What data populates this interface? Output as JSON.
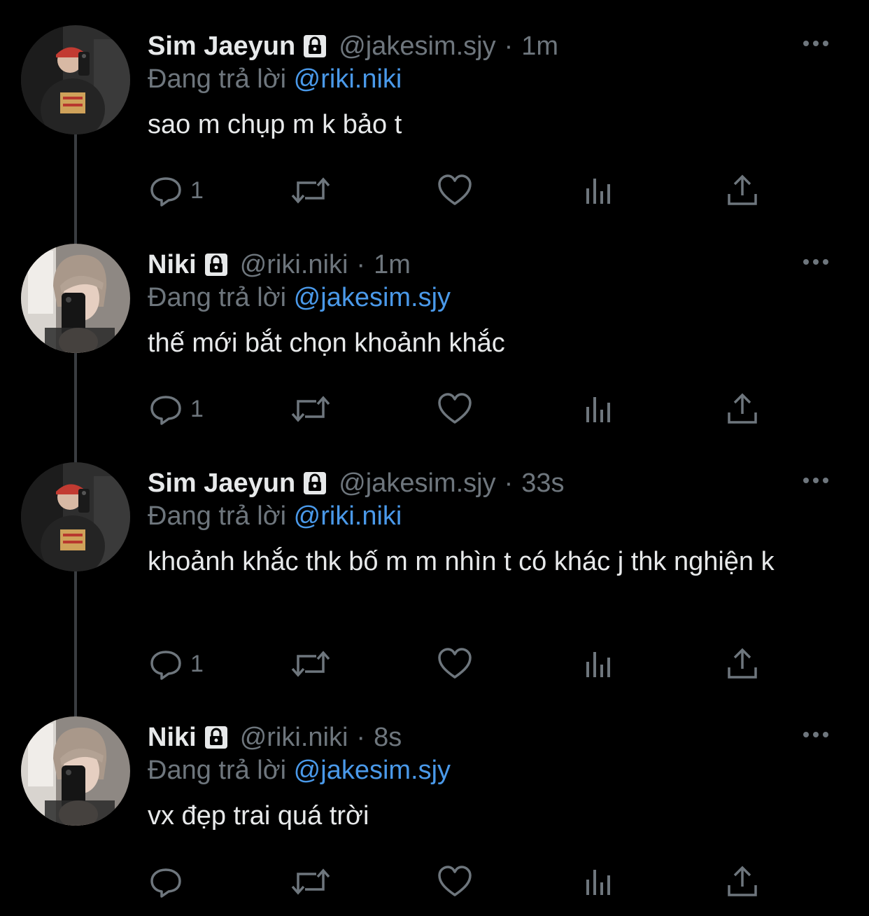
{
  "reply_prefix": "Đang trả lời",
  "separator": "·",
  "colors": {
    "background": "#000000",
    "text": "#e7e9ea",
    "muted": "#6e767d",
    "link": "#4a99e9",
    "thread_line": "#3a3d41"
  },
  "icons": {
    "protected": "lock-icon",
    "more": "more-horizontal-icon",
    "reply": "reply-bubble-icon",
    "retweet": "retweet-icon",
    "like": "heart-icon",
    "views": "bar-chart-icon",
    "share": "share-upload-icon"
  },
  "tweets": [
    {
      "display_name": "Sim Jaeyun",
      "handle": "@jakesim.sjy",
      "time": "1m",
      "reply_to": "@riki.niki",
      "text": "sao m chụp m k bảo t",
      "reply_count": "1",
      "avatar": "red-cap-mirror-selfie"
    },
    {
      "display_name": "Niki",
      "handle": "@riki.niki",
      "time": "1m",
      "reply_to": "@jakesim.sjy",
      "text": "thế mới bắt chọn khoảnh khắc",
      "reply_count": "1",
      "avatar": "phone-mirror-selfie"
    },
    {
      "display_name": "Sim Jaeyun",
      "handle": "@jakesim.sjy",
      "time": "33s",
      "reply_to": "@riki.niki",
      "text": "khoảnh khắc thk bố m m nhìn t có khác j thk nghiện k",
      "reply_count": "1",
      "avatar": "red-cap-mirror-selfie"
    },
    {
      "display_name": "Niki",
      "handle": "@riki.niki",
      "time": "8s",
      "reply_to": "@jakesim.sjy",
      "text": "vx đẹp trai quá trời",
      "reply_count": "",
      "avatar": "phone-mirror-selfie"
    }
  ]
}
